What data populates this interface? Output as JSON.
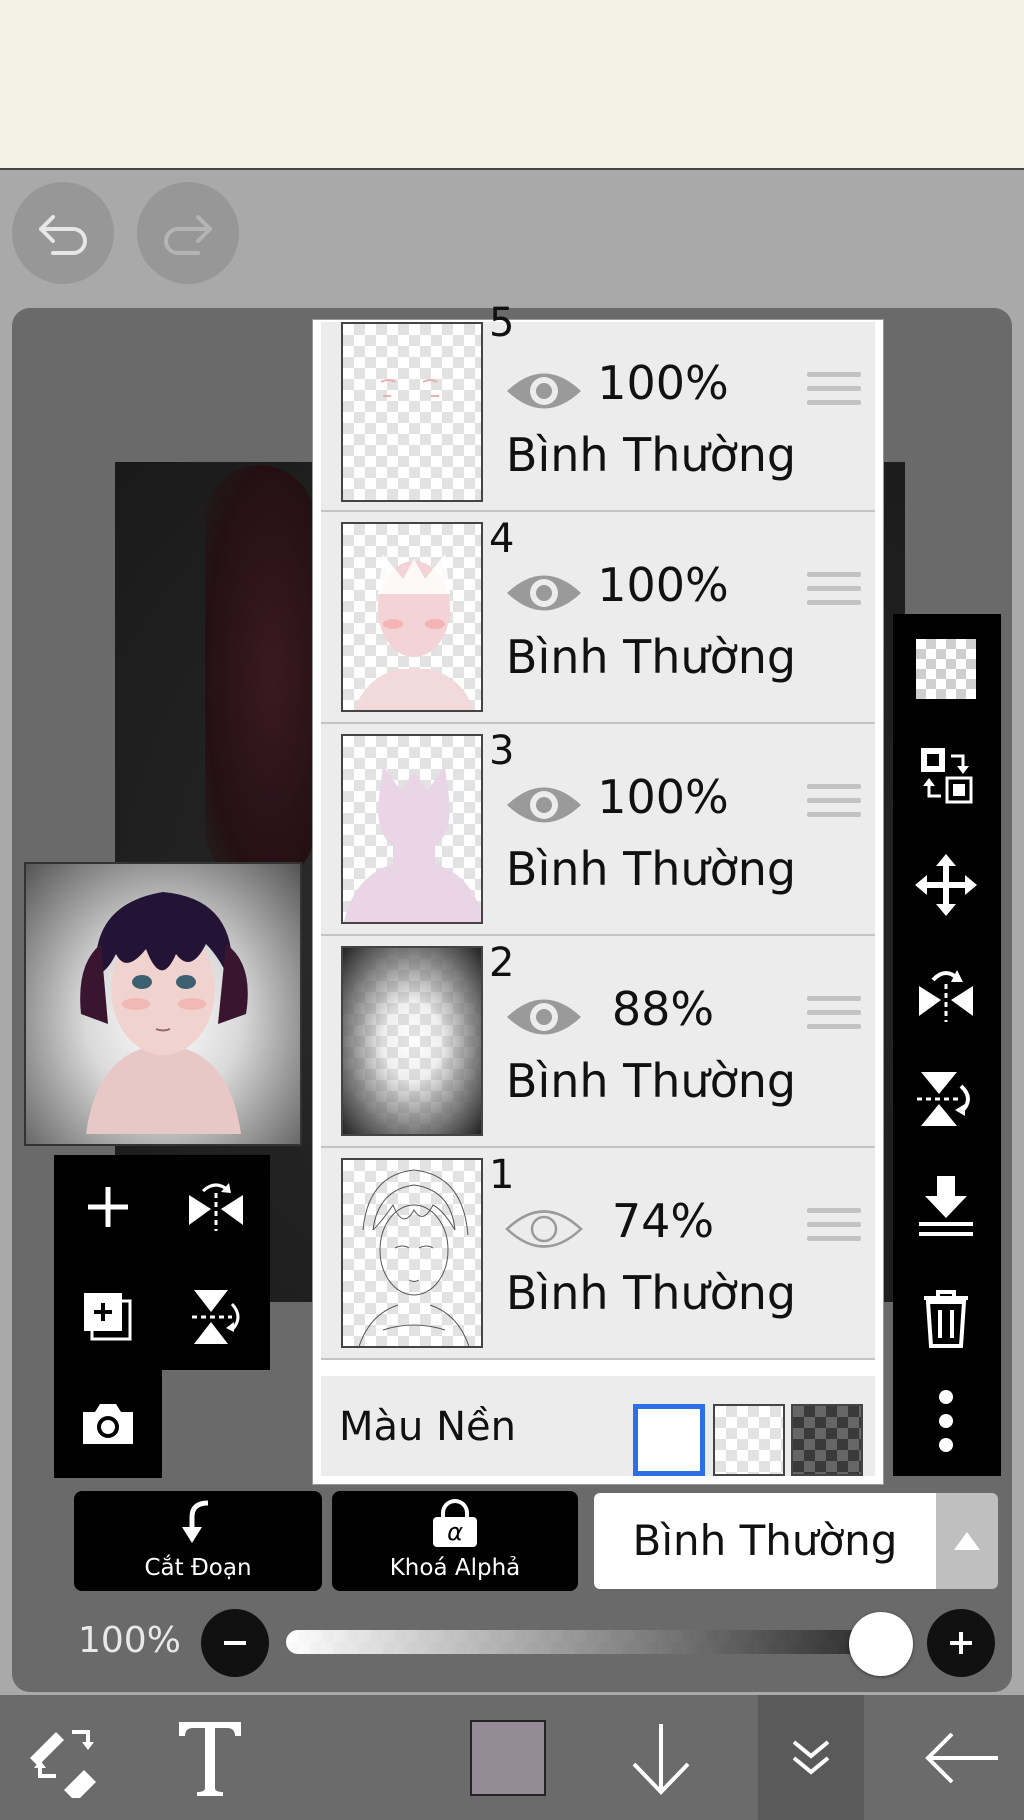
{
  "history": {
    "undo_icon": "undo-icon",
    "redo_icon": "redo-icon"
  },
  "layers": [
    {
      "number": "5",
      "opacity": "100%",
      "mode": "Bình Thường",
      "visible": true
    },
    {
      "number": "4",
      "opacity": "100%",
      "mode": "Bình Thường",
      "visible": true
    },
    {
      "number": "3",
      "opacity": "100%",
      "mode": "Bình Thường",
      "visible": true
    },
    {
      "number": "2",
      "opacity": "88%",
      "mode": "Bình Thường",
      "visible": true
    },
    {
      "number": "1",
      "opacity": "74%",
      "mode": "Bình Thường",
      "visible": false
    }
  ],
  "background": {
    "label": "Màu Nền",
    "selected_color": "#2f6fe6"
  },
  "buttons": {
    "clipping_label": "Cắt Đoạn",
    "alpha_lock_label": "Khoá Alphả",
    "alpha_symbol": "α"
  },
  "blend_mode": {
    "value": "Bình Thường"
  },
  "opacity_control": {
    "label": "100%",
    "value": 1.0
  },
  "colors": {
    "current_color": "#948b96",
    "sidebar_bg": "#000000",
    "panel_bg": "#ececec"
  },
  "sidebar_icons": [
    "transparency-icon",
    "layer-swap-icon",
    "move-icon",
    "flip-horizontal-icon",
    "flip-vertical-icon",
    "merge-down-icon",
    "trash-icon",
    "more-icon"
  ],
  "left_tools": [
    "add-layer-icon",
    "flip-horizontal-icon",
    "duplicate-layer-icon",
    "flip-vertical-icon",
    "camera-icon"
  ],
  "bottom_bar": [
    "transform-icon",
    "text-tool-icon",
    "color-swatch",
    "download-icon",
    "layers-icon",
    "back-arrow-icon"
  ]
}
